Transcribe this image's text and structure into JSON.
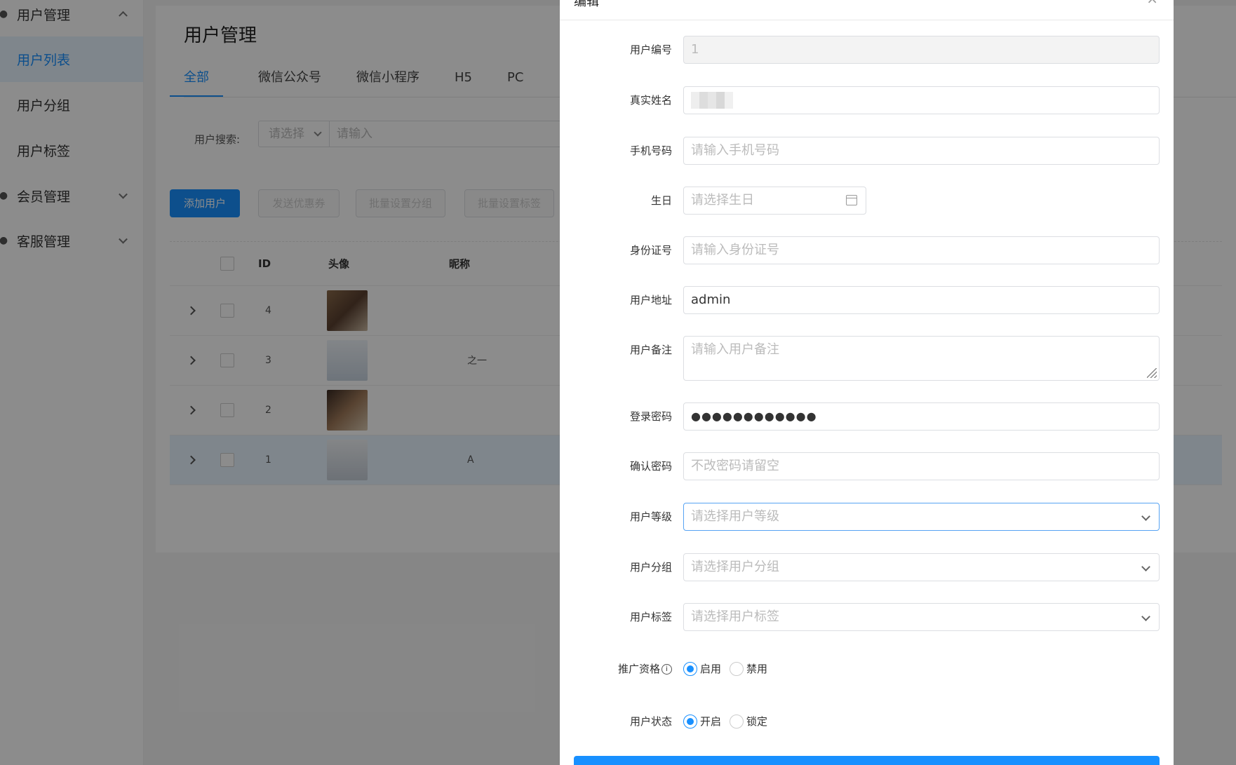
{
  "sidebar": {
    "groups": [
      {
        "label": "用户管理",
        "items": [
          "用户列表",
          "用户分组",
          "用户标签"
        ]
      },
      {
        "label": "会员管理"
      },
      {
        "label": "客服管理"
      }
    ]
  },
  "main": {
    "title": "用户管理",
    "tabs": [
      "全部",
      "微信公众号",
      "微信小程序",
      "H5",
      "PC"
    ],
    "search": {
      "label": "用户搜索:",
      "select_placeholder": "请选择",
      "input_placeholder": "请输入"
    },
    "actions": [
      "添加用户",
      "发送优惠券",
      "批量设置分组",
      "批量设置标签"
    ],
    "table": {
      "columns": [
        "ID",
        "头像",
        "昵称"
      ],
      "rows": [
        {
          "id": "4",
          "nickname": ""
        },
        {
          "id": "3",
          "nickname": "之一"
        },
        {
          "id": "2",
          "nickname": ""
        },
        {
          "id": "1",
          "nickname": "A"
        }
      ]
    }
  },
  "modal": {
    "title": "编辑",
    "close": "×",
    "fields": {
      "user_id": {
        "label": "用户编号",
        "value": "1"
      },
      "real_name": {
        "label": "真实姓名",
        "value": ""
      },
      "phone": {
        "label": "手机号码",
        "placeholder": "请输入手机号码"
      },
      "birthday": {
        "label": "生日",
        "placeholder": "请选择生日"
      },
      "id_card": {
        "label": "身份证号",
        "placeholder": "请输入身份证号"
      },
      "address": {
        "label": "用户地址",
        "value": "admin"
      },
      "remark": {
        "label": "用户备注",
        "placeholder": "请输入用户备注"
      },
      "password": {
        "label": "登录密码",
        "value": "●●●●●●●●●●●●"
      },
      "confirm_password": {
        "label": "确认密码",
        "placeholder": "不改密码请留空"
      },
      "level": {
        "label": "用户等级",
        "placeholder": "请选择用户等级"
      },
      "group": {
        "label": "用户分组",
        "placeholder": "请选择用户分组"
      },
      "tags": {
        "label": "用户标签",
        "placeholder": "请选择用户标签"
      },
      "promotion": {
        "label": "推广资格",
        "info": "i",
        "options": [
          "启用",
          "禁用"
        ],
        "selected": "启用"
      },
      "status": {
        "label": "用户状态",
        "options": [
          "开启",
          "锁定"
        ],
        "selected": "开启"
      }
    }
  }
}
